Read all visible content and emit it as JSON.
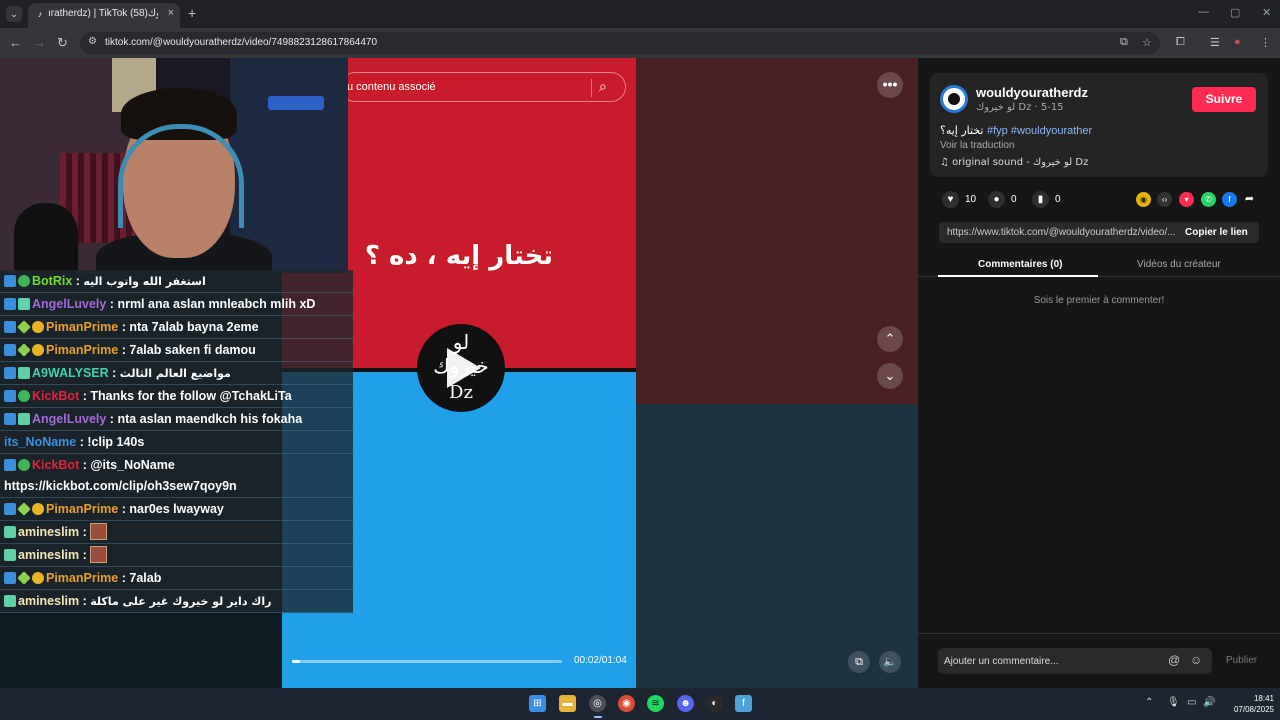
{
  "browser": {
    "tab_title": "ıratherdz) | TikTok لو خيروك(58)",
    "tab_close": "×",
    "new_tab": "+",
    "url": "tiktok.com/@wouldyouratherdz/video/7498823128617864470"
  },
  "video": {
    "search_placeholder": "u contenu associé",
    "overlay_text": "تختار إيه ، ده ؟",
    "logo_line1": "لو",
    "logo_line2": "خيروك",
    "logo_line3": "Dz",
    "time": "00:02/01:04",
    "progress": 0.03
  },
  "chat": [
    {
      "badges": [
        "mod",
        "ver"
      ],
      "user": "BotRix",
      "color": "#6fdc2f",
      "msg": "استغفر الله واتوب اليه",
      "rtl": true
    },
    {
      "badges": [
        "mod",
        "og"
      ],
      "user": "AngelLuvely",
      "color": "#a36ad8",
      "msg": "nrml ana aslan mnleabch mlih xD"
    },
    {
      "badges": [
        "mod",
        "vip",
        "gold"
      ],
      "user": "PimanPrime",
      "color": "#e8a02a",
      "msg": "nta 7alab bayna 2eme"
    },
    {
      "badges": [
        "mod",
        "vip",
        "gold"
      ],
      "user": "PimanPrime",
      "color": "#e8a02a",
      "msg": "7alab saken fi damou"
    },
    {
      "badges": [
        "mod",
        "og"
      ],
      "user": "A9WALYSER",
      "color": "#3fd3a8",
      "msg": "مواضيع العالم الثالث",
      "rtl": true
    },
    {
      "badges": [
        "mod",
        "ver"
      ],
      "user": "KickBot",
      "color": "#e0233c",
      "msg": "Thanks for the follow @TchakLiTa"
    },
    {
      "badges": [
        "mod",
        "og"
      ],
      "user": "AngelLuvely",
      "color": "#a36ad8",
      "msg": "nta aslan maendkch his fokaha"
    },
    {
      "badges": [],
      "user": "its_NoName",
      "color": "#3d8fe0",
      "msg": "!clip 140s"
    },
    {
      "badges": [
        "mod",
        "ver"
      ],
      "user": "KickBot",
      "color": "#e0233c",
      "msg": "@its_NoName",
      "msg2": "https://kickbot.com/clip/oh3sew7qoy9n"
    },
    {
      "badges": [
        "mod",
        "vip",
        "gold"
      ],
      "user": "PimanPrime",
      "color": "#e8a02a",
      "msg": "nar0es lwayway"
    },
    {
      "badges": [
        "og"
      ],
      "user": "amineslim",
      "color": "#f2e6b5",
      "emote": true
    },
    {
      "badges": [
        "og"
      ],
      "user": "amineslim",
      "color": "#f2e6b5",
      "emote": true
    },
    {
      "badges": [
        "mod",
        "vip",
        "gold"
      ],
      "user": "PimanPrime",
      "color": "#e8a02a",
      "msg": "7alab"
    },
    {
      "badges": [
        "og"
      ],
      "user": "amineslim",
      "color": "#f2e6b5",
      "msg": "راك داير لو خيروك غير على ماكلة",
      "rtl": true
    }
  ],
  "panel": {
    "username": "wouldyouratherdz",
    "subline": "لو خيروك Dz · 5-15",
    "follow": "Suivre",
    "desc_ar": "تختار إيه؟",
    "desc_tags": "#fyp #wouldyourather",
    "translate": "Voir la traduction",
    "sound": "original sound - لو خيروك Dz",
    "likes": "10",
    "comments": "0",
    "saves": "0",
    "link": "https://www.tiktok.com/@wouldyouratherdz/video/...",
    "copy": "Copier le lien",
    "tab_comments": "Commentaires (0)",
    "tab_videos": "Vidéos du créateur",
    "empty": "Sois le premier à commenter!",
    "comment_placeholder": "Ajouter un commentaire...",
    "publish": "Publier"
  },
  "taskbar": {
    "time": "18:41",
    "date": "07/08/2025"
  }
}
